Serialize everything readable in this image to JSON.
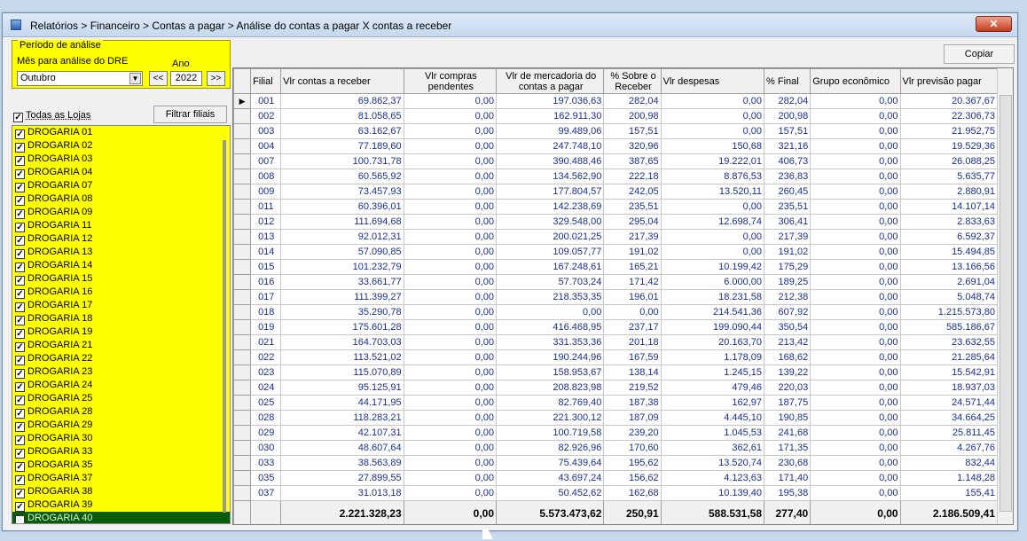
{
  "window": {
    "title": "Relatórios > Financeiro > Contas a pagar > Análise do contas a pagar X contas a receber",
    "close_label": "✕"
  },
  "period": {
    "legend": "Período de análise",
    "month_label": "Mês para análise do DRE",
    "month_value": "Outubro",
    "year_label": "Ano",
    "year_value": "2022",
    "prev_label": "<<",
    "next_label": ">>"
  },
  "stores": {
    "all_label": "Todas as Lojas",
    "filter_label": "Filtrar filiais",
    "items": [
      "DROGARIA 01",
      "DROGARIA 02",
      "DROGARIA 03",
      "DROGARIA 04",
      "DROGARIA 07",
      "DROGARIA 08",
      "DROGARIA 09",
      "DROGARIA 11",
      "DROGARIA 12",
      "DROGARIA 13",
      "DROGARIA 14",
      "DROGARIA 15",
      "DROGARIA 16",
      "DROGARIA 17",
      "DROGARIA 18",
      "DROGARIA 19",
      "DROGARIA 21",
      "DROGARIA 22",
      "DROGARIA 23",
      "DROGARIA 24",
      "DROGARIA 25",
      "DROGARIA 28",
      "DROGARIA 29",
      "DROGARIA 30",
      "DROGARIA 33",
      "DROGARIA 35",
      "DROGARIA 37",
      "DROGARIA 38",
      "DROGARIA 39",
      "DROGARIA 40"
    ]
  },
  "copy_label": "Copiar",
  "table": {
    "headers": [
      "Filial",
      "Vlr contas a receber",
      "Vlr compras pendentes",
      "Vlr de mercadoria do contas a pagar",
      "% Sobre o Receber",
      "Vlr despesas",
      "% Final",
      "Grupo econômico",
      "Vlr previsão pagar"
    ],
    "rows": [
      [
        "001",
        "69.862,37",
        "0,00",
        "197.036,63",
        "282,04",
        "0,00",
        "282,04",
        "0,00",
        "20.367,67"
      ],
      [
        "002",
        "81.058,65",
        "0,00",
        "162.911,30",
        "200,98",
        "0,00",
        "200,98",
        "0,00",
        "22.306,73"
      ],
      [
        "003",
        "63.162,67",
        "0,00",
        "99.489,06",
        "157,51",
        "0,00",
        "157,51",
        "0,00",
        "21.952,75"
      ],
      [
        "004",
        "77.189,60",
        "0,00",
        "247.748,10",
        "320,96",
        "150,68",
        "321,16",
        "0,00",
        "19.529,36"
      ],
      [
        "007",
        "100.731,78",
        "0,00",
        "390.488,46",
        "387,65",
        "19.222,01",
        "406,73",
        "0,00",
        "26.088,25"
      ],
      [
        "008",
        "60.565,92",
        "0,00",
        "134.562,90",
        "222,18",
        "8.876,53",
        "236,83",
        "0,00",
        "5.635,77"
      ],
      [
        "009",
        "73.457,93",
        "0,00",
        "177.804,57",
        "242,05",
        "13.520,11",
        "260,45",
        "0,00",
        "2.880,91"
      ],
      [
        "011",
        "60.396,01",
        "0,00",
        "142.238,69",
        "235,51",
        "0,00",
        "235,51",
        "0,00",
        "14.107,14"
      ],
      [
        "012",
        "111.694,68",
        "0,00",
        "329.548,00",
        "295,04",
        "12.698,74",
        "306,41",
        "0,00",
        "2.833,63"
      ],
      [
        "013",
        "92.012,31",
        "0,00",
        "200.021,25",
        "217,39",
        "0,00",
        "217,39",
        "0,00",
        "6.592,37"
      ],
      [
        "014",
        "57.090,85",
        "0,00",
        "109.057,77",
        "191,02",
        "0,00",
        "191,02",
        "0,00",
        "15.494,85"
      ],
      [
        "015",
        "101.232,79",
        "0,00",
        "167.248,61",
        "165,21",
        "10.199,42",
        "175,29",
        "0,00",
        "13.166,56"
      ],
      [
        "016",
        "33.661,77",
        "0,00",
        "57.703,24",
        "171,42",
        "6.000,00",
        "189,25",
        "0,00",
        "2.691,04"
      ],
      [
        "017",
        "111.399,27",
        "0,00",
        "218.353,35",
        "196,01",
        "18.231,58",
        "212,38",
        "0,00",
        "5.048,74"
      ],
      [
        "018",
        "35.290,78",
        "0,00",
        "0,00",
        "0,00",
        "214.541,36",
        "607,92",
        "0,00",
        "1.215.573,80"
      ],
      [
        "019",
        "175.601,28",
        "0,00",
        "416.468,95",
        "237,17",
        "199.090,44",
        "350,54",
        "0,00",
        "585.186,67"
      ],
      [
        "021",
        "164.703,03",
        "0,00",
        "331.353,36",
        "201,18",
        "20.163,70",
        "213,42",
        "0,00",
        "23.632,55"
      ],
      [
        "022",
        "113.521,02",
        "0,00",
        "190.244,96",
        "167,59",
        "1.178,09",
        "168,62",
        "0,00",
        "21.285,64"
      ],
      [
        "023",
        "115.070,89",
        "0,00",
        "158.953,67",
        "138,14",
        "1.245,15",
        "139,22",
        "0,00",
        "15.542,91"
      ],
      [
        "024",
        "95.125,91",
        "0,00",
        "208.823,98",
        "219,52",
        "479,46",
        "220,03",
        "0,00",
        "18.937,03"
      ],
      [
        "025",
        "44.171,95",
        "0,00",
        "82.769,40",
        "187,38",
        "162,97",
        "187,75",
        "0,00",
        "24.571,44"
      ],
      [
        "028",
        "118.283,21",
        "0,00",
        "221.300,12",
        "187,09",
        "4.445,10",
        "190,85",
        "0,00",
        "34.664,25"
      ],
      [
        "029",
        "42.107,31",
        "0,00",
        "100.719,58",
        "239,20",
        "1.045,53",
        "241,68",
        "0,00",
        "25.811,45"
      ],
      [
        "030",
        "48.607,64",
        "0,00",
        "82.926,96",
        "170,60",
        "362,61",
        "171,35",
        "0,00",
        "4.267,76"
      ],
      [
        "033",
        "38.563,89",
        "0,00",
        "75.439,64",
        "195,62",
        "13.520,74",
        "230,68",
        "0,00",
        "832,44"
      ],
      [
        "035",
        "27.899,55",
        "0,00",
        "43.697,24",
        "156,62",
        "4.123,63",
        "171,40",
        "0,00",
        "1.148,28"
      ],
      [
        "037",
        "31.013,18",
        "0,00",
        "50.452,62",
        "162,68",
        "10.139,40",
        "195,38",
        "0,00",
        "155,41"
      ]
    ],
    "totals": [
      "",
      "2.221.328,23",
      "0,00",
      "5.573.473,62",
      "250,91",
      "588.531,58",
      "277,40",
      "0,00",
      "2.186.509,41"
    ]
  }
}
